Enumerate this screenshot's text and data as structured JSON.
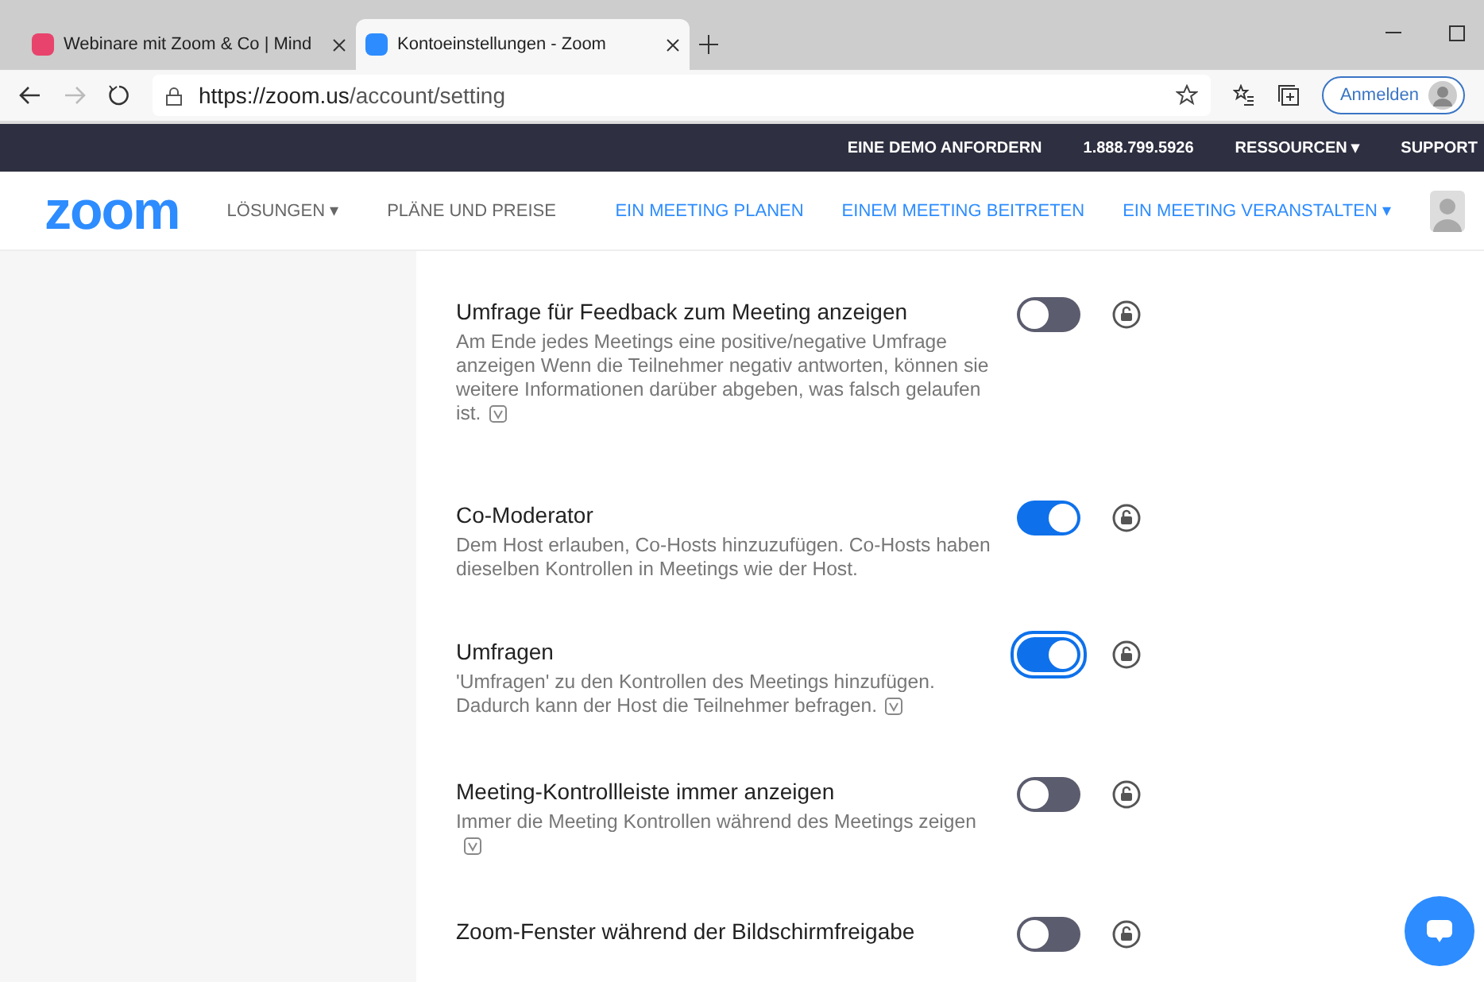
{
  "browser": {
    "tabs": [
      {
        "title": "Webinare mit Zoom & Co | Mind",
        "selected": false
      },
      {
        "title": "Kontoeinstellungen - Zoom",
        "selected": true
      }
    ],
    "url_host": "https://zoom.us",
    "url_path": "/account/setting",
    "sign_in": "Anmelden"
  },
  "top_nav": [
    "EINE DEMO ANFORDERN",
    "1.888.799.5926",
    "RESSOURCEN ▾",
    "SUPPORT"
  ],
  "header": {
    "logo": "zoom",
    "left_links": [
      "LÖSUNGEN ▾",
      "PLÄNE UND PREISE"
    ],
    "right_links": [
      "EIN MEETING PLANEN",
      "EINEM MEETING BEITRETEN",
      "EIN MEETING VERANSTALTEN ▾"
    ]
  },
  "settings": [
    {
      "title": "Umfrage für Feedback zum Meeting anzeigen",
      "description": "Am Ende jedes Meetings eine positive/negative Umfrage anzeigen Wenn die Teilnehmer negativ antworten, können sie weitere Informationen darüber abgeben, was falsch gelaufen ist.",
      "info": true,
      "on": false,
      "focused": false
    },
    {
      "title": "Co-Moderator",
      "description": "Dem Host erlauben, Co-Hosts hinzuzufügen. Co-Hosts haben dieselben Kontrollen in Meetings wie der Host.",
      "info": false,
      "on": true,
      "focused": false
    },
    {
      "title": "Umfragen",
      "description": "'Umfragen' zu den Kontrollen des Meetings hinzufügen. Dadurch kann der Host die Teilnehmer befragen.",
      "info": true,
      "on": true,
      "focused": true
    },
    {
      "title": "Meeting-Kontrollleiste immer anzeigen",
      "description": "Immer die Meeting Kontrollen während des Meetings zeigen",
      "info": true,
      "on": false,
      "focused": false
    },
    {
      "title": "Zoom-Fenster während der Bildschirmfreigabe",
      "on": false,
      "focused": false
    }
  ]
}
